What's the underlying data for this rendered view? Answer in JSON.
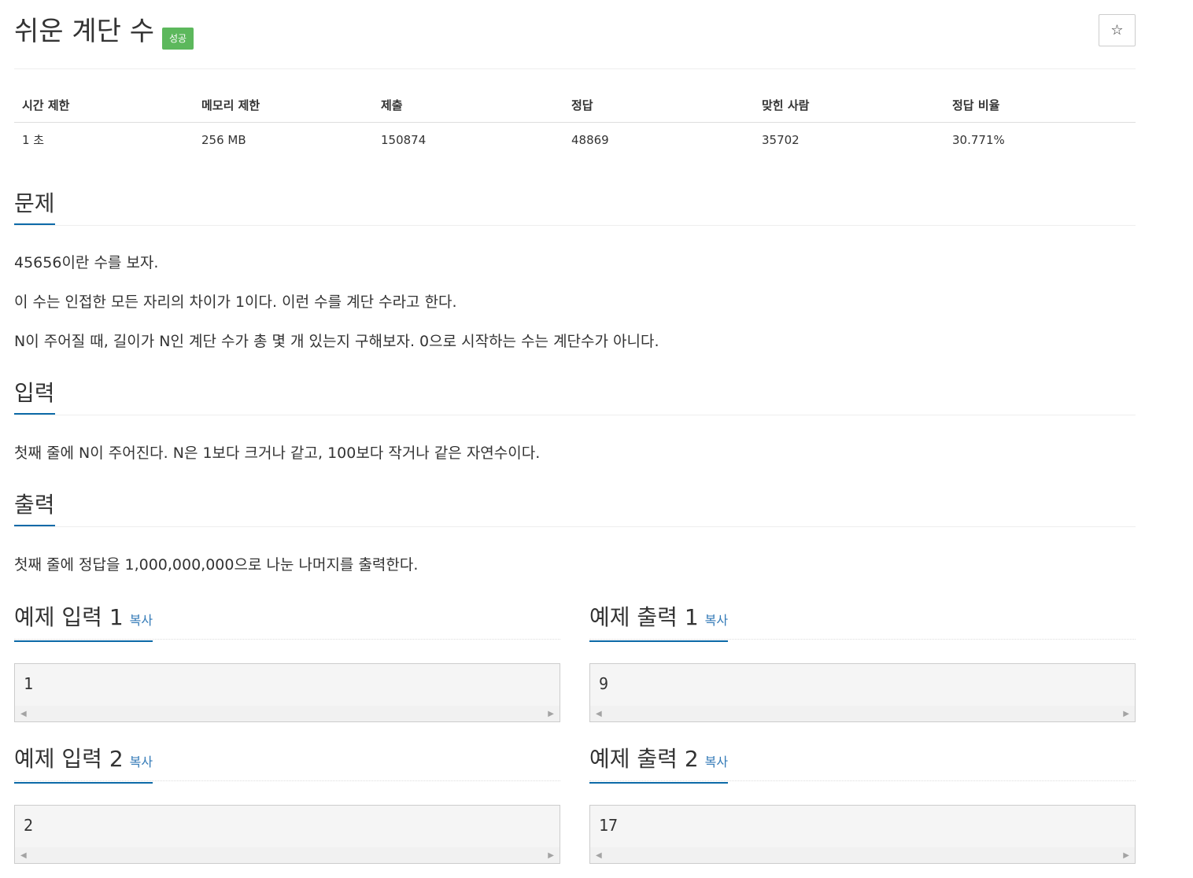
{
  "problem": {
    "title": "쉬운 계단 수",
    "status_badge": "성공",
    "star_icon": "☆"
  },
  "info": {
    "headers": [
      "시간 제한",
      "메모리 제한",
      "제출",
      "정답",
      "맞힌 사람",
      "정답 비율"
    ],
    "values": [
      "1 초",
      "256 MB",
      "150874",
      "48869",
      "35702",
      "30.771%"
    ]
  },
  "sections": {
    "problem": {
      "title": "문제",
      "paragraphs": [
        "45656이란 수를 보자.",
        "이 수는 인접한 모든 자리의 차이가 1이다. 이런 수를 계단 수라고 한다.",
        "N이 주어질 때, 길이가 N인 계단 수가 총 몇 개 있는지 구해보자. 0으로 시작하는 수는 계단수가 아니다."
      ]
    },
    "input": {
      "title": "입력",
      "text": "첫째 줄에 N이 주어진다. N은 1보다 크거나 같고, 100보다 작거나 같은 자연수이다."
    },
    "output": {
      "title": "출력",
      "text": "첫째 줄에 정답을 1,000,000,000으로 나눈 나머지를 출력한다."
    }
  },
  "samples": {
    "copy_label": "복사",
    "input1": {
      "title": "예제 입력 1",
      "value": "1"
    },
    "output1": {
      "title": "예제 출력 1",
      "value": "9"
    },
    "input2": {
      "title": "예제 입력 2",
      "value": "2"
    },
    "output2": {
      "title": "예제 출력 2",
      "value": "17"
    }
  },
  "scroll_glyphs": {
    "left": "◀",
    "right": "▶"
  }
}
